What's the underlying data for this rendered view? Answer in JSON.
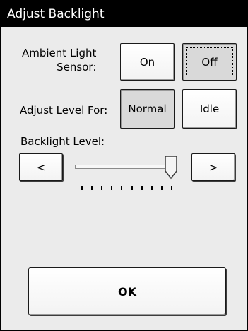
{
  "title": "Adjust Backlight",
  "ambient": {
    "label": "Ambient Light\nSensor:",
    "on_label": "On",
    "off_label": "Off",
    "selected": "Off"
  },
  "adjust_level": {
    "label": "Adjust Level For:",
    "normal_label": "Normal",
    "idle_label": "Idle",
    "selected": "Normal"
  },
  "backlight": {
    "label": "Backlight Level:",
    "decrease_label": "<",
    "increase_label": ">",
    "level": 1.0,
    "tick_count": 10
  },
  "ok_label": "OK"
}
